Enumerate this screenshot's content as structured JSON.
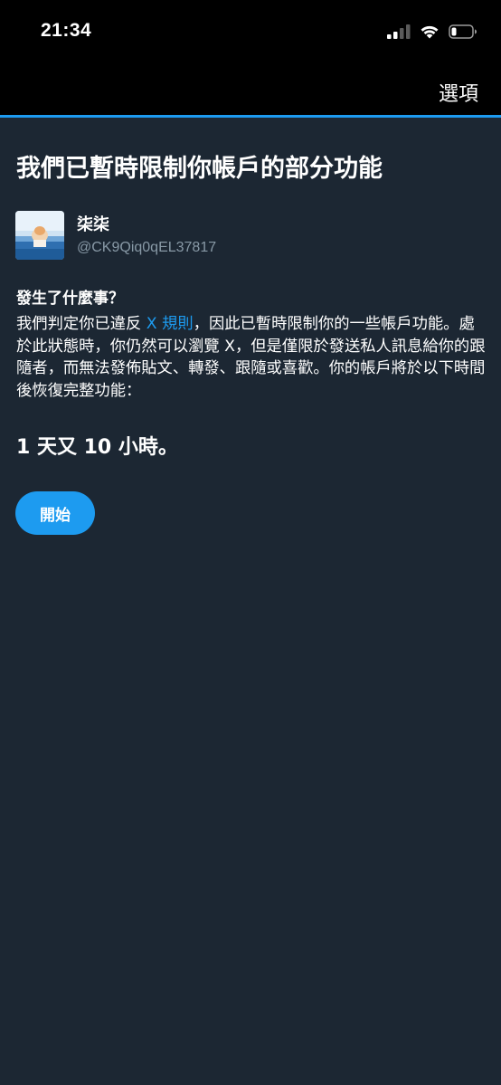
{
  "status_bar": {
    "time": "21:34",
    "icons": [
      "cellular-signal-icon",
      "wifi-icon",
      "battery-icon"
    ]
  },
  "nav": {
    "options_label": "選項"
  },
  "title": "我們已暫時限制你帳戶的部分功能",
  "profile": {
    "display_name": "柒柒",
    "handle": "@CK9Qiq0qEL37817"
  },
  "section": {
    "heading": "發生了什麼事？",
    "body_before_link": "我們判定你已違反 ",
    "link_text": "X 規則",
    "body_after_link": "，因此已暫時限制你的一些帳戶功能。處於此狀態時，你仍然可以瀏覽 X，但是僅限於發送私人訊息給你的跟隨者，而無法發佈貼文、轉發、跟隨或喜歡。你的帳戶將於以下時間後恢復完整功能："
  },
  "time_remaining": "1 天又 10 小時。",
  "start_button_label": "開始",
  "colors": {
    "background": "#1c2733",
    "accent": "#1d9bf0",
    "secondary_text": "#8899a6"
  }
}
